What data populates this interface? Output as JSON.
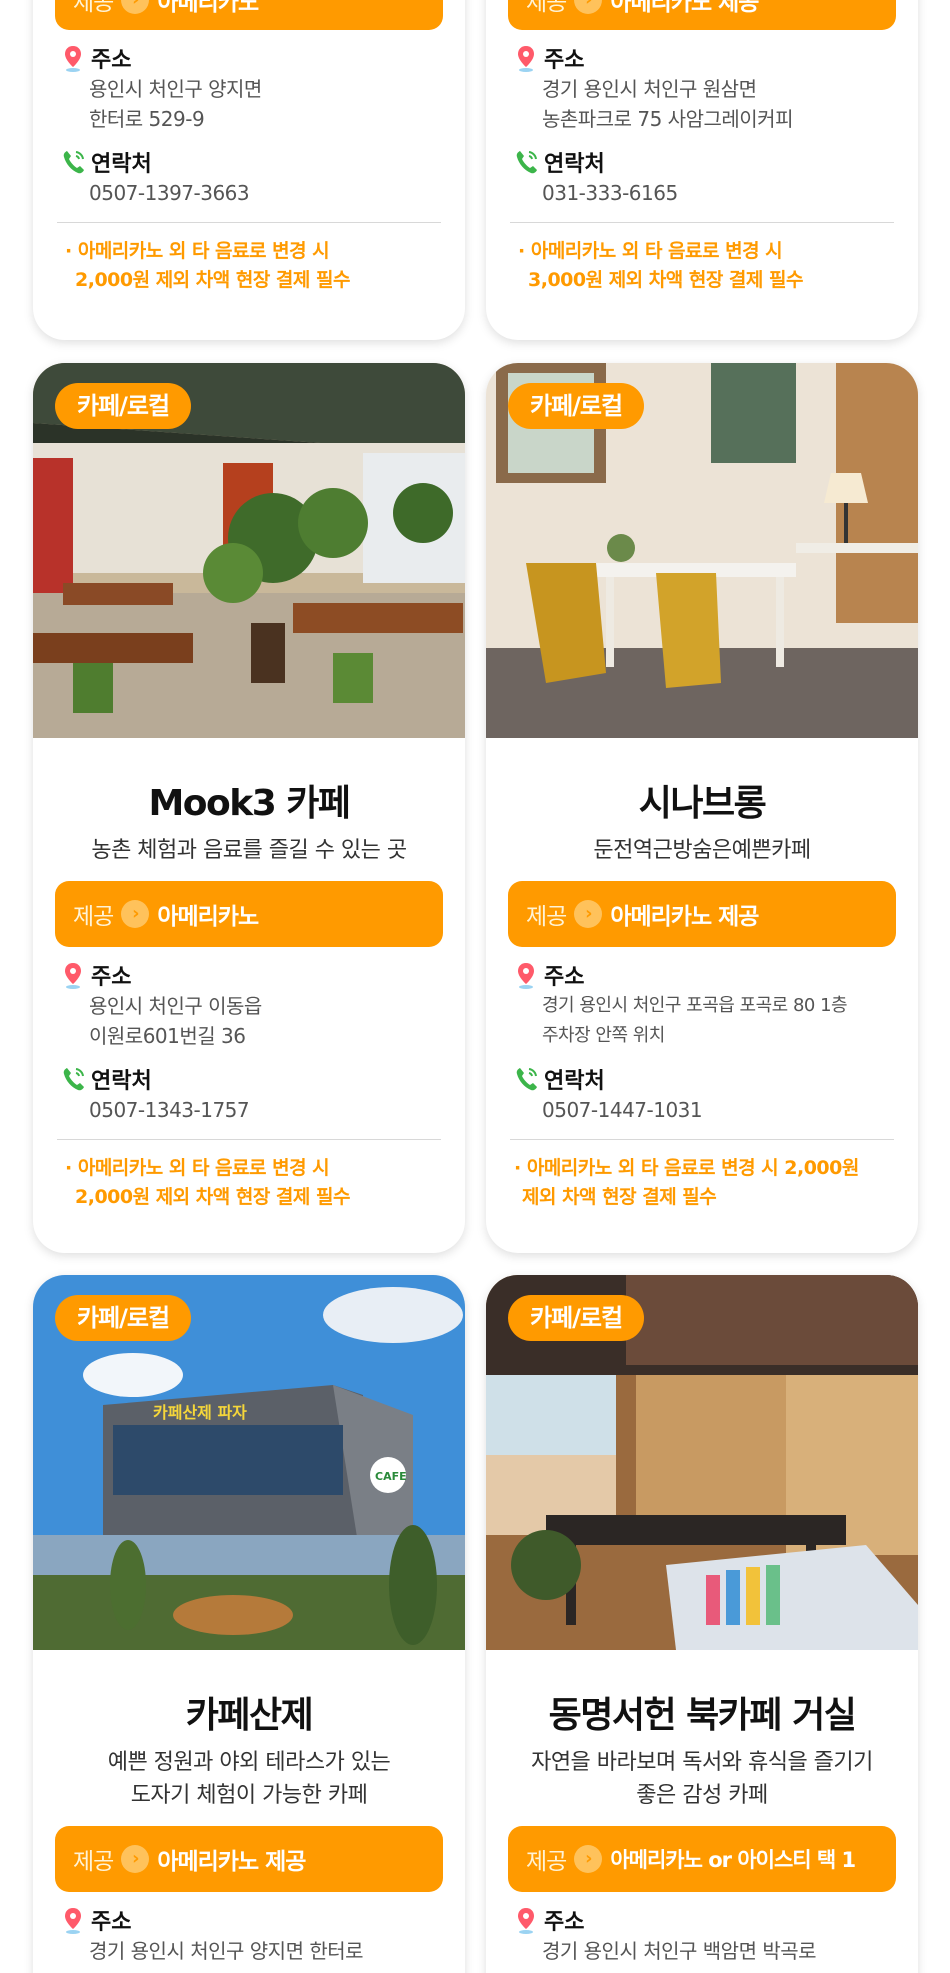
{
  "common": {
    "category": "카페/로컬",
    "offer_label": "제공",
    "address_label": "주소",
    "contact_label": "연락처"
  },
  "cards_top": [
    {
      "offer_label_partial": "제공",
      "offer_value_partial": "아메리카노",
      "address_lines": [
        "용인시 처인구 양지면",
        "한터로 529-9"
      ],
      "phone": "0507-1397-3663",
      "note_lines": [
        "· 아메리카노 외 타 음료로 변경 시",
        "2,000원 제외 차액 현장 결제 필수"
      ]
    },
    {
      "offer_label_partial": "제공",
      "offer_value_partial": "아메리카노 제공",
      "address_lines": [
        "경기 용인시 처인구 원삼면",
        "농촌파크로 75 사암그레이커피"
      ],
      "phone": "031-333-6165",
      "note_lines": [
        "· 아메리카노 외 타 음료로 변경 시",
        "3,000원 제외 차액 현장 결제 필수"
      ]
    }
  ],
  "cards_mid": [
    {
      "title": "Mook3 카페",
      "desc_lines": [
        "농촌 체험과 음료를 즐길 수 있는 곳"
      ],
      "offer_value": "아메리카노",
      "address_lines": [
        "용인시 처인구 이동읍",
        "이원로601번길 36"
      ],
      "phone": "0507-1343-1757",
      "note_lines": [
        "· 아메리카노 외 타 음료로 변경 시",
        "2,000원 제외 차액 현장 결제 필수"
      ]
    },
    {
      "title": "시나브롱",
      "desc_lines": [
        "둔전역근방숨은예쁜카페"
      ],
      "offer_value": "아메리카노 제공",
      "address_lines": [
        "경기 용인시 처인구 포곡읍 포곡로 80 1층",
        "주차장 안쪽 위치"
      ],
      "phone": "0507-1447-1031",
      "note_lines": [
        "· 아메리카노 외 타 음료로 변경 시 2,000원",
        "제외 차액 현장 결제 필수"
      ]
    }
  ],
  "cards_bottom": [
    {
      "title": "카페산제",
      "desc_lines": [
        "예쁜 정원과 야외 테라스가 있는",
        "도자기 체험이 가능한 카페"
      ],
      "offer_value": "아메리카노 제공",
      "photo_sign": "카페산제 파자",
      "photo_sign2": "CAFE",
      "address_lines": [
        "경기 용인시 처인구 양지면 한터로"
      ]
    },
    {
      "title": "동명서헌 북카페 거실",
      "desc_lines": [
        "자연을 바라보며 독서와 휴식을 즐기기",
        "좋은 감성 카페"
      ],
      "offer_value": "아메리카노 or 아이스티 택 1",
      "address_lines": [
        "경기 용인시 처인구 백암면 박곡로"
      ]
    }
  ],
  "colors": {
    "accent": "#ff9a00",
    "pin": "#ff5a6a",
    "phone": "#3cb54a"
  },
  "icons": {
    "address": "location-pin-icon",
    "contact": "phone-icon",
    "arrow": "chevron-right-circle-icon"
  }
}
